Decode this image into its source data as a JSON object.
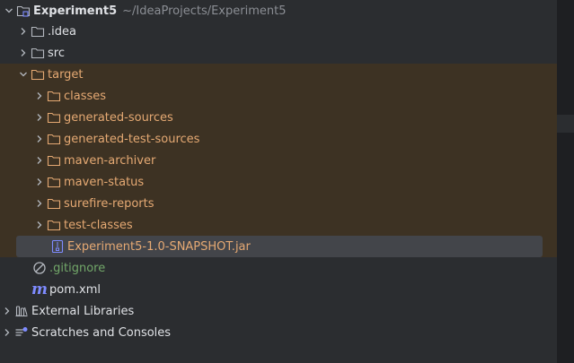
{
  "project": {
    "name": "Experiment5",
    "path": "~/IdeaProjects/Experiment5"
  },
  "tree": {
    "idea": ".idea",
    "src": "src",
    "target": "target",
    "classes": "classes",
    "generated_sources": "generated-sources",
    "generated_test_sources": "generated-test-sources",
    "maven_archiver": "maven-archiver",
    "maven_status": "maven-status",
    "surefire_reports": "surefire-reports",
    "test_classes": "test-classes",
    "jar": "Experiment5-1.0-SNAPSHOT.jar",
    "gitignore": ".gitignore",
    "pom": "pom.xml",
    "external_libraries": "External Libraries",
    "scratches": "Scratches and Consoles"
  },
  "colors": {
    "background": "#2b2d30",
    "excluded_background": "#3d3223",
    "selected_background": "#43454a",
    "excluded_text": "#e5a973",
    "ignored_text": "#72a769",
    "maven_icon": "#7e8bff"
  }
}
